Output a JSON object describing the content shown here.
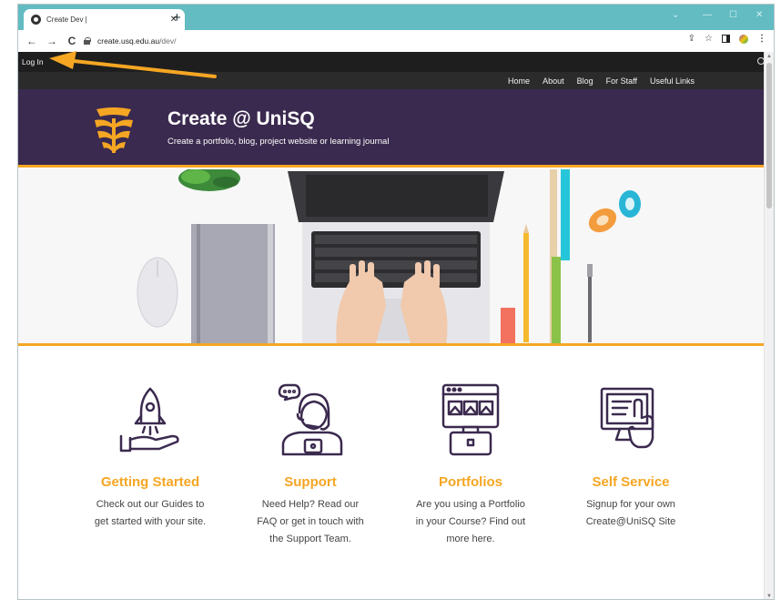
{
  "browser": {
    "tab_title": "Create Dev |",
    "tab_close": "✕",
    "new_tab": "+",
    "url_host": "create.usq.edu.au",
    "url_path": "/dev/",
    "nav": {
      "back": "←",
      "forward": "→",
      "reload": "C"
    },
    "toolbar_icons": {
      "share": "⇪",
      "bookmark": "☆",
      "menu": "⋮"
    },
    "window_controls": {
      "chevron": "⌄",
      "minimize": "—",
      "maximize": "☐",
      "close": "✕"
    }
  },
  "adminbar": {
    "login_label": "Log In"
  },
  "nav": {
    "items": [
      {
        "label": "Home"
      },
      {
        "label": "About"
      },
      {
        "label": "Blog"
      },
      {
        "label": "For Staff"
      },
      {
        "label": "Useful Links"
      }
    ]
  },
  "header": {
    "title": "Create @ UniSQ",
    "tagline": "Create a portfolio, blog, project website or learning journal"
  },
  "features": [
    {
      "title": "Getting Started",
      "body": "Check out our Guides to get started with your site.",
      "icon": "rocket-hand-icon"
    },
    {
      "title": "Support",
      "body": "Need Help? Read our FAQ or get in touch with the Support Team.",
      "icon": "support-agent-icon"
    },
    {
      "title": "Portfolios",
      "body": "Are you using a Portfolio in your Course? Find out more here.",
      "icon": "portfolio-icon"
    },
    {
      "title": "Self Service",
      "body": "Signup for your own Create@UniSQ Site",
      "icon": "self-service-icon"
    }
  ],
  "colors": {
    "header_bg": "#3b2a4f",
    "accent": "#f5a623",
    "tabstrip": "#62bcc2",
    "adminbar": "#1e1e1e"
  }
}
